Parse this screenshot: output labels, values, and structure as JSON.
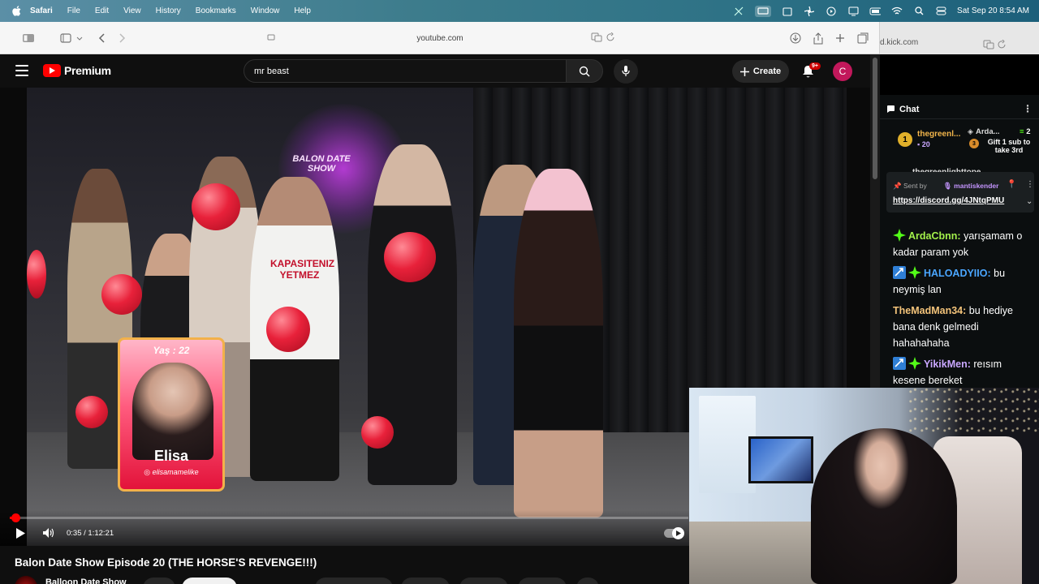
{
  "menubar": {
    "app": "Safari",
    "items": [
      "File",
      "Edit",
      "View",
      "History",
      "Bookmarks",
      "Window",
      "Help"
    ],
    "date_time": "Sat Sep 20  8:54 AM"
  },
  "safari": {
    "address": "youtube.com",
    "second_tab_address": "d.kick.com"
  },
  "youtube": {
    "brand": "Premium",
    "search_value": "mr beast",
    "create_label": "Create",
    "notif_count": "9+",
    "avatar_letter": "C",
    "video_title": "Balon Date Show Episode 20 (THE HORSE'S REVENGE!!!)",
    "channel_name": "Balloon Date Show",
    "player": {
      "time": "0:35 / 1:12:21",
      "progress_fraction": 0.008
    },
    "overlay_card": {
      "age": "Yaş : 22",
      "name": "Elisa",
      "handle": "elisamamelike"
    },
    "shirt_text": "KAPASITENIZ YETMEZ",
    "sign_text": "BALON DATE SHOW"
  },
  "kick": {
    "chat_title": "Chat",
    "gifters": {
      "first_rank": "1",
      "first_name": "thegreenl...",
      "first_count": "20",
      "second_name": "Arda...",
      "second_count": "2",
      "third_rank": "3",
      "third_text": "Gift 1 sub to take 3rd"
    },
    "pinned": {
      "sent_by_label": "Sent by",
      "sender": "mantiskender",
      "link": "https://discord.gg/4JNtqPMU",
      "partial_name": "thegreenlighttope"
    },
    "messages": [
      {
        "user": "ArdaCbnn:",
        "text": "yarışamam o kadar param yok",
        "color": "#a3f04b"
      },
      {
        "user": "HALOADYIIO:",
        "text": "bu neymiş lan",
        "color": "#4aa6ff"
      },
      {
        "user": "TheMadMan34:",
        "text": "bu hediye bana denk gelmedi hahahahaha",
        "color": "#f3c37a"
      },
      {
        "user": "YikikMen:",
        "text": "reısım kesene bereket",
        "color": "#c9a7ff"
      }
    ]
  }
}
